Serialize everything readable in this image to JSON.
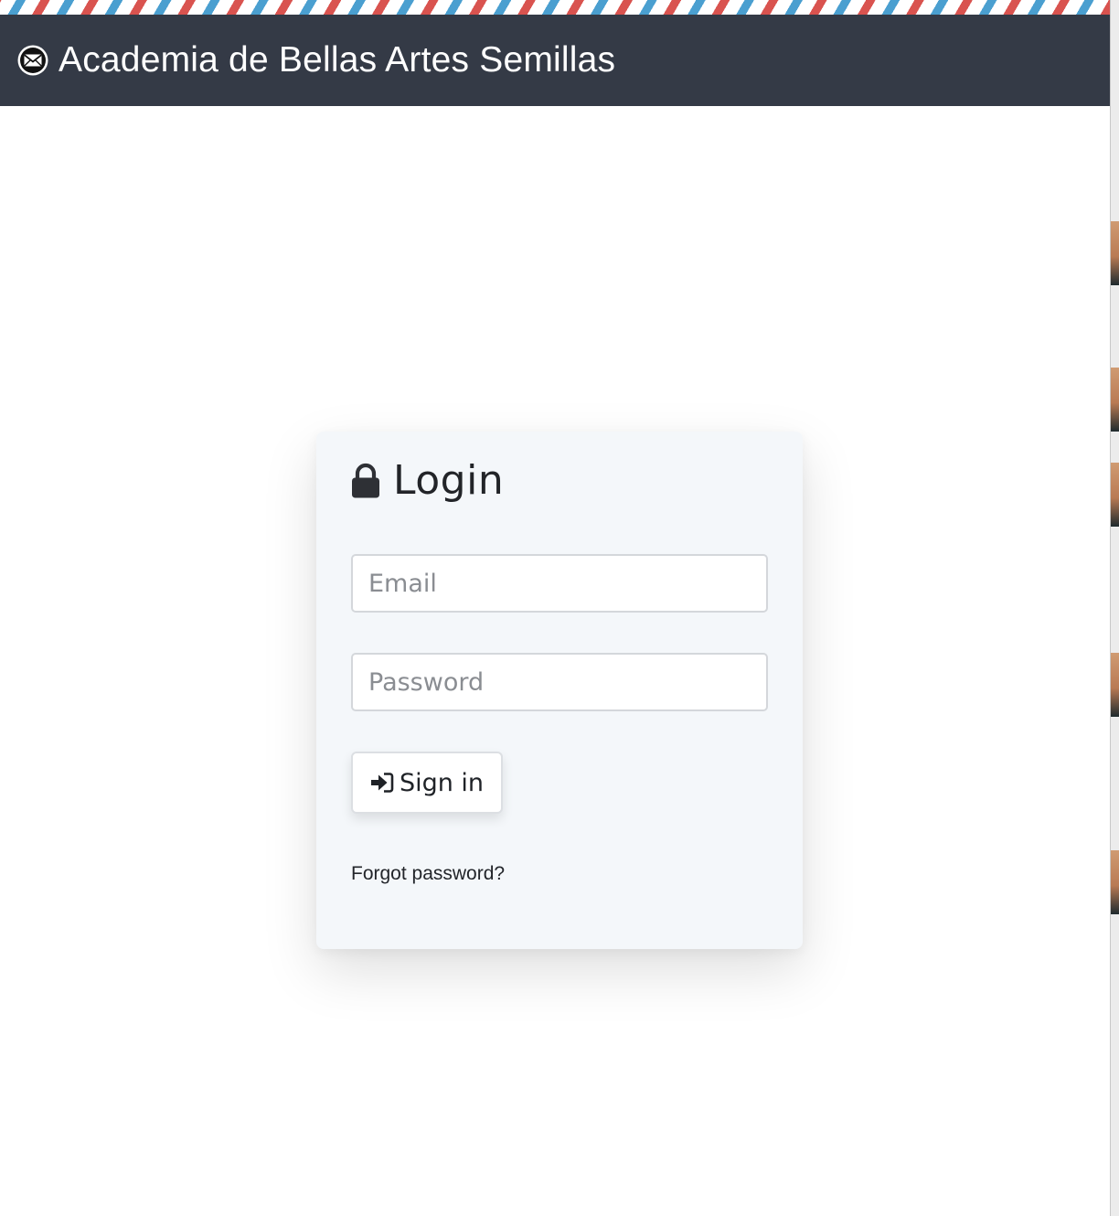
{
  "header": {
    "logo_icon": "envelope-icon",
    "title": "Academia de Bellas Artes Semillas",
    "background": "#343a46"
  },
  "login": {
    "title_icon": "lock-icon",
    "title": "Login",
    "email_placeholder": "Email",
    "email_value": "",
    "password_placeholder": "Password",
    "password_value": "",
    "signin_icon": "sign-in-icon",
    "signin_label": "Sign in",
    "forgot_label": "Forgot password?"
  }
}
